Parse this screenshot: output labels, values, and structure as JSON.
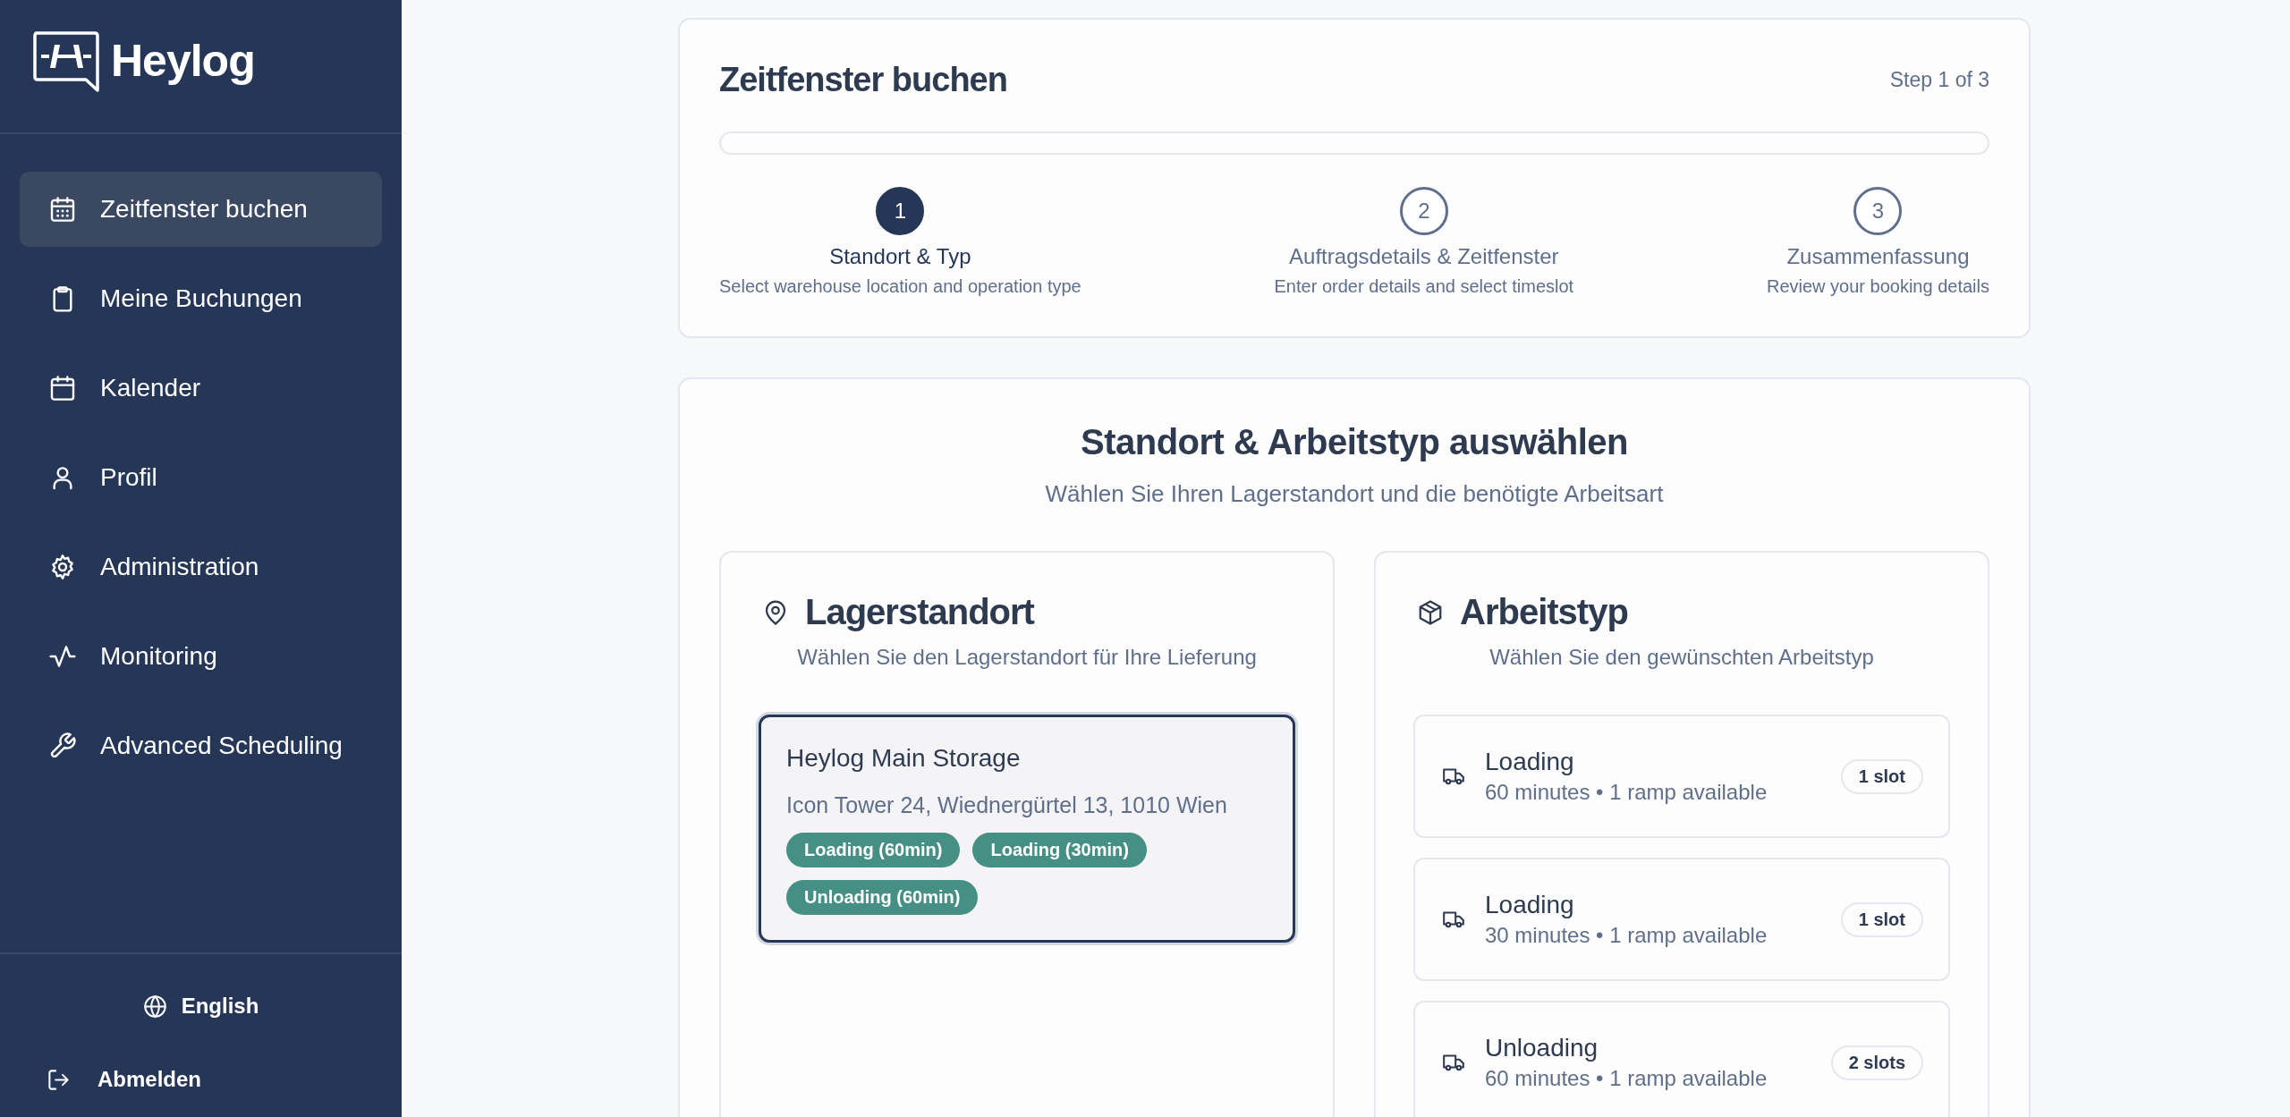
{
  "brand": {
    "name": "Heylog"
  },
  "sidebar": {
    "items": [
      {
        "label": "Zeitfenster buchen",
        "kind": "calendar-grid",
        "selected": true
      },
      {
        "label": "Meine Buchungen",
        "kind": "clipboard",
        "selected": false
      },
      {
        "label": "Kalender",
        "kind": "calendar",
        "selected": false
      },
      {
        "label": "Profil",
        "kind": "user",
        "selected": false
      },
      {
        "label": "Administration",
        "kind": "gear",
        "selected": false
      },
      {
        "label": "Monitoring",
        "kind": "pulse",
        "selected": false
      },
      {
        "label": "Advanced Scheduling",
        "kind": "wrench",
        "selected": false
      }
    ],
    "language": "English",
    "logout": "Abmelden"
  },
  "wizard": {
    "title": "Zeitfenster buchen",
    "step_text": "Step 1 of 3",
    "progress": {
      "level": 0
    },
    "steps": [
      {
        "number": "1",
        "label": "Standort & Typ",
        "description": "Select warehouse location and operation type",
        "selected": true
      },
      {
        "number": "2",
        "label": "Auftragsdetails & Zeitfenster",
        "description": "Enter order details and select timeslot",
        "selected": false
      },
      {
        "number": "3",
        "label": "Zusammenfassung",
        "description": "Review your booking details",
        "selected": false
      }
    ]
  },
  "selection": {
    "title": "Standort & Arbeitstyp auswählen",
    "subtitle": "Wählen Sie Ihren Lagerstandort und die benötigte Arbeitsart",
    "location_panel": {
      "title": "Lagerstandort",
      "subtitle": "Wählen Sie den Lagerstandort für Ihre Lieferung",
      "locations": [
        {
          "name": "Heylog Main Storage",
          "address": "Icon Tower 24, Wiednergürtel 13, 1010 Wien",
          "selected": true,
          "tags": [
            "Loading (60min)",
            "Loading (30min)",
            "Unloading (60min)"
          ]
        }
      ]
    },
    "type_panel": {
      "title": "Arbeitstyp",
      "subtitle": "Wählen Sie den gewünschten Arbeitstyp",
      "types": [
        {
          "name": "Loading",
          "details": "60 minutes • 1 ramp available",
          "slots": "1 slot",
          "selected": false
        },
        {
          "name": "Loading",
          "details": "30 minutes • 1 ramp available",
          "slots": "1 slot",
          "selected": false
        },
        {
          "name": "Unloading",
          "details": "60 minutes • 1 ramp available",
          "slots": "2 slots",
          "selected": false
        }
      ]
    }
  }
}
